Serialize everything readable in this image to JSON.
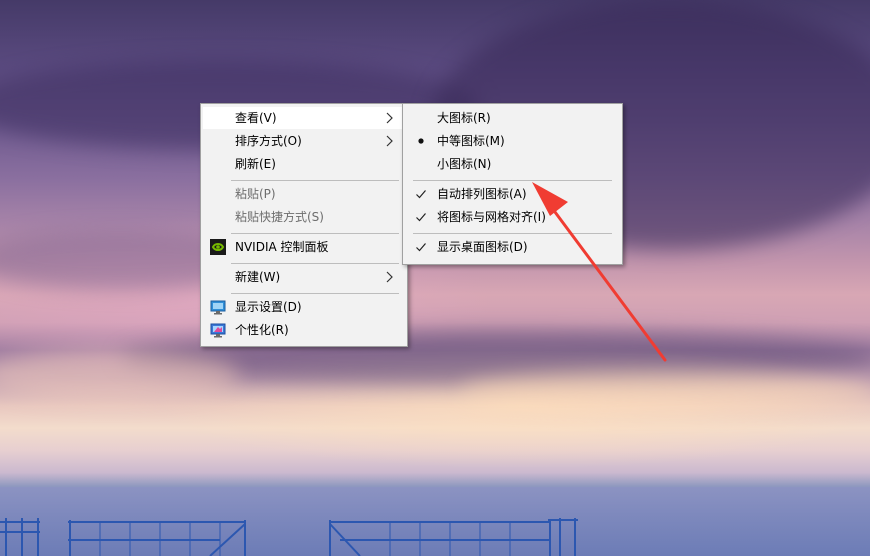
{
  "context_menu": {
    "items": [
      {
        "label": "查看(V)"
      },
      {
        "label": "排序方式(O)"
      },
      {
        "label": "刷新(E)"
      },
      {
        "label": "粘贴(P)"
      },
      {
        "label": "粘贴快捷方式(S)"
      },
      {
        "label": "NVIDIA 控制面板"
      },
      {
        "label": "新建(W)"
      },
      {
        "label": "显示设置(D)"
      },
      {
        "label": "个性化(R)"
      }
    ]
  },
  "view_submenu": {
    "items": [
      {
        "label": "大图标(R)"
      },
      {
        "label": "中等图标(M)"
      },
      {
        "label": "小图标(N)"
      },
      {
        "label": "自动排列图标(A)"
      },
      {
        "label": "将图标与网格对齐(I)"
      },
      {
        "label": "显示桌面图标(D)"
      }
    ]
  },
  "colors": {
    "annotation_arrow": "#f03c32",
    "menu_background": "#f2f2f2",
    "highlight": "#ffffff",
    "nvidia_green": "#76b900"
  }
}
